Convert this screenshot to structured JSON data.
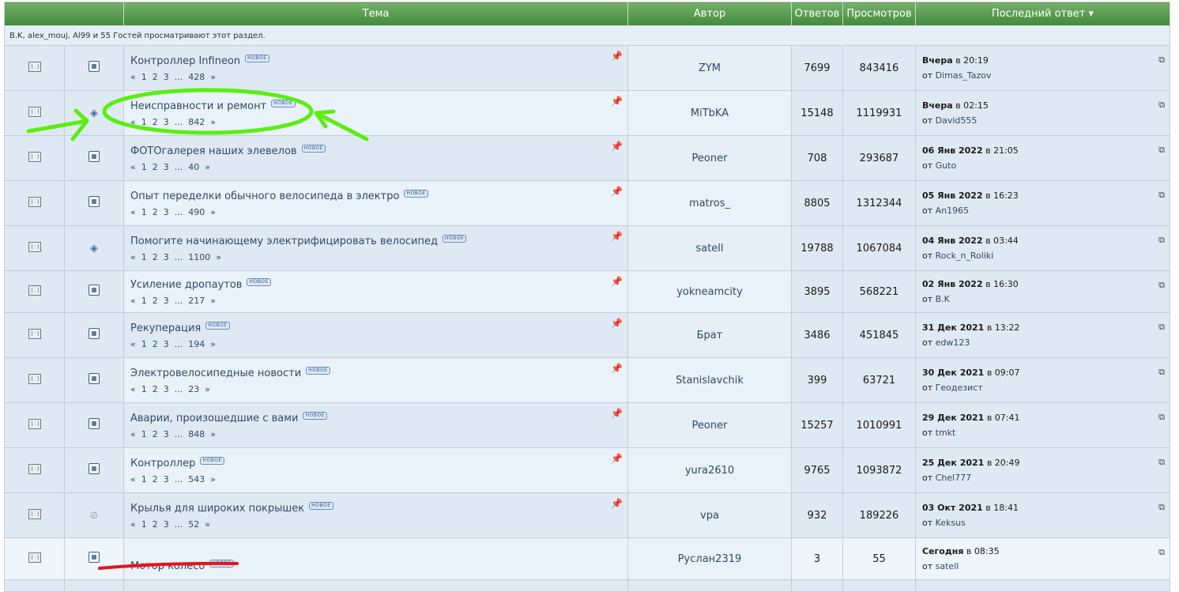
{
  "header": {
    "topic": "Тема",
    "author": "Автор",
    "replies": "Ответов",
    "views": "Просмотров",
    "last_post": "Последний ответ",
    "sort_icon": "triangle-down-icon"
  },
  "viewers_text": "B.K, alex_mouj, Al99 и 55 Гостей просматривают этот раздел.",
  "new_badge": "НОВОЕ",
  "from_label": "от",
  "topics": [
    {
      "title": "Контроллер Infineon",
      "pages": [
        "«",
        "1",
        "2",
        "3",
        "...",
        "428",
        "»"
      ],
      "author": "ZYM",
      "replies": "7699",
      "views": "843416",
      "last_day": "Вчера",
      "last_time": "в 20:19",
      "last_user": "Dimas_Tazov"
    },
    {
      "title": "Неисправности и ремонт",
      "pages": [
        "«",
        "1",
        "2",
        "3",
        "...",
        "842",
        "»"
      ],
      "author": "MiTbKA",
      "replies": "15148",
      "views": "1119931",
      "last_day": "Вчера",
      "last_time": "в 02:15",
      "last_user": "David555"
    },
    {
      "title": "ФОТОгалерея наших элевелов",
      "pages": [
        "«",
        "1",
        "2",
        "3",
        "...",
        "40",
        "»"
      ],
      "author": "Peoner",
      "replies": "708",
      "views": "293687",
      "last_day": "06 Янв 2022",
      "last_time": "в 21:05",
      "last_user": "Guto"
    },
    {
      "title": "Опыт переделки обычного велосипеда в электро",
      "pages": [
        "«",
        "1",
        "2",
        "3",
        "...",
        "490",
        "»"
      ],
      "author": "matros_",
      "replies": "8805",
      "views": "1312344",
      "last_day": "05 Янв 2022",
      "last_time": "в 16:23",
      "last_user": "An1965"
    },
    {
      "title": "Помогите начинающему электрифицировать велосипед",
      "pages": [
        "«",
        "1",
        "2",
        "3",
        "...",
        "1100",
        "»"
      ],
      "author": "satell",
      "replies": "19788",
      "views": "1067084",
      "last_day": "04 Янв 2022",
      "last_time": "в 03:44",
      "last_user": "Rock_n_Roliki"
    },
    {
      "title": "Усиление дропаутов",
      "pages": [
        "«",
        "1",
        "2",
        "3",
        "...",
        "217",
        "»"
      ],
      "author": "yokneamcity",
      "replies": "3895",
      "views": "568221",
      "last_day": "02 Янв 2022",
      "last_time": "в 16:30",
      "last_user": "B.K"
    },
    {
      "title": "Рекуперация",
      "pages": [
        "«",
        "1",
        "2",
        "3",
        "...",
        "194",
        "»"
      ],
      "author": "Брат",
      "replies": "3486",
      "views": "451845",
      "last_day": "31 Дек 2021",
      "last_time": "в 13:22",
      "last_user": "edw123"
    },
    {
      "title": "Электровелосипедные новости",
      "pages": [
        "«",
        "1",
        "2",
        "3",
        "...",
        "23",
        "»"
      ],
      "author": "Stanislavchik",
      "replies": "399",
      "views": "63721",
      "last_day": "30 Дек 2021",
      "last_time": "в 09:07",
      "last_user": "Геодезист"
    },
    {
      "title": "Аварии, произошедшие с вами",
      "pages": [
        "«",
        "1",
        "2",
        "3",
        "...",
        "848",
        "»"
      ],
      "author": "Peoner",
      "replies": "15257",
      "views": "1010991",
      "last_day": "29 Дек 2021",
      "last_time": "в 07:41",
      "last_user": "tmkt"
    },
    {
      "title": "Контроллер",
      "pages": [
        "«",
        "1",
        "2",
        "3",
        "...",
        "543",
        "»"
      ],
      "author": "yura2610",
      "replies": "9765",
      "views": "1093872",
      "last_day": "25 Дек 2021",
      "last_time": "в 20:49",
      "last_user": "Chel777"
    },
    {
      "title": "Крылья для широких покрышек",
      "pages": [
        "«",
        "1",
        "2",
        "3",
        "...",
        "52",
        "»"
      ],
      "author": "vpa",
      "replies": "932",
      "views": "189226",
      "last_day": "03 Окт 2021",
      "last_time": "в 18:41",
      "last_user": "Keksus"
    },
    {
      "title": "Мотор колесо",
      "pages": [],
      "author": "Руслан2319",
      "replies": "3",
      "views": "55",
      "last_day": "Сегодня",
      "last_time": "в 08:35",
      "last_user": "satell"
    }
  ],
  "icons": {
    "status": [
      "folder-hot-icon",
      "folder-icon",
      "folder-icon",
      "folder-icon",
      "folder-icon",
      "folder-hot-icon",
      "folder-icon",
      "folder-hot-icon",
      "folder-hot-icon",
      "folder-icon",
      "folder-icon",
      "folder-new-icon"
    ],
    "topic_type": [
      "box-icon",
      "diamond-icon",
      "box-icon",
      "box-icon",
      "diamond-icon",
      "box-icon",
      "box-icon",
      "box-icon",
      "box-icon",
      "box-icon",
      "paperclip-icon",
      "box-icon"
    ]
  },
  "annotation_colors": {
    "green": "#5aee12",
    "red": "#e8121a"
  }
}
